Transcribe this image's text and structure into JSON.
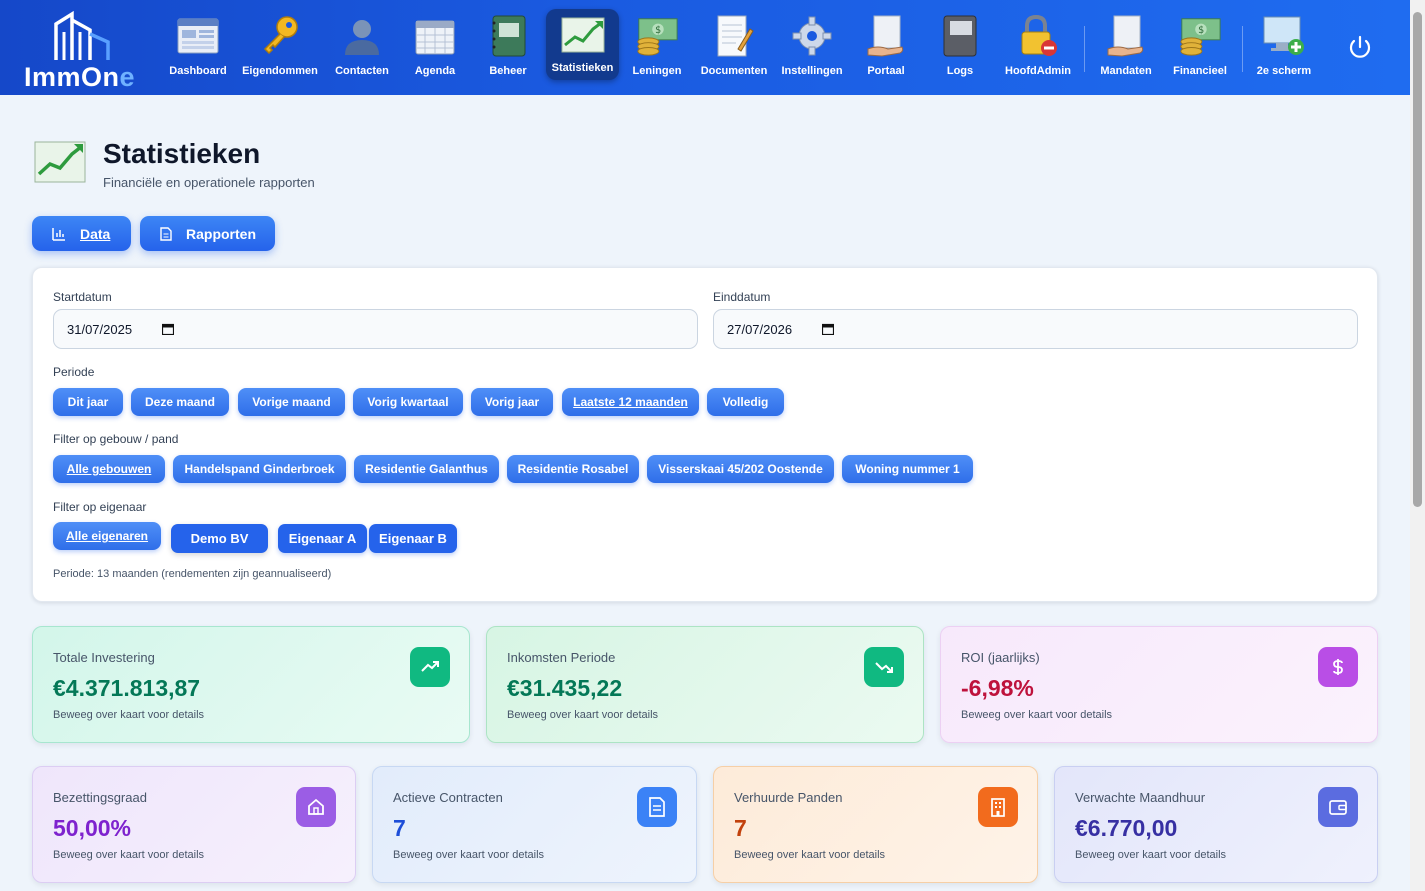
{
  "app": {
    "logo_text": "ImmOne"
  },
  "nav": {
    "items": [
      {
        "label": "Dashboard"
      },
      {
        "label": "Eigendommen"
      },
      {
        "label": "Contacten"
      },
      {
        "label": "Agenda"
      },
      {
        "label": "Beheer"
      },
      {
        "label": "Statistieken"
      },
      {
        "label": "Leningen"
      },
      {
        "label": "Documenten"
      },
      {
        "label": "Instellingen"
      },
      {
        "label": "Portaal"
      },
      {
        "label": "Logs"
      },
      {
        "label": "HoofdAdmin"
      },
      {
        "label": "Mandaten"
      },
      {
        "label": "Financieel"
      },
      {
        "label": "2e scherm"
      }
    ],
    "active": "Statistieken"
  },
  "page": {
    "title": "Statistieken",
    "subtitle": "Financiële en operationele rapporten"
  },
  "tabs": {
    "data": "Data",
    "rapporten": "Rapporten"
  },
  "filters": {
    "start_label": "Startdatum",
    "start_value": "31/07/2025",
    "end_label": "Einddatum",
    "end_value": "27/07/2026",
    "period_label": "Periode",
    "periods": [
      "Dit jaar",
      "Deze maand",
      "Vorige maand",
      "Vorig kwartaal",
      "Vorig jaar",
      "Laatste 12 maanden",
      "Volledig"
    ],
    "building_label": "Filter op gebouw / pand",
    "buildings": [
      "Alle gebouwen",
      "Handelspand Ginderbroek",
      "Residentie Galanthus",
      "Residentie Rosabel",
      "Visserskaai 45/202 Oostende",
      "Woning nummer 1"
    ],
    "owner_label": "Filter op eigenaar",
    "owners": [
      "Alle eigenaren",
      "Demo BV",
      "Eigenaar A",
      "Eigenaar B"
    ],
    "period_note": "Periode: 13 maanden (rendementen zijn geannualiseerd)"
  },
  "stats": {
    "hint": "Beweeg over kaart voor details",
    "cards": [
      {
        "label": "Totale Investering",
        "value": "€4.371.813,87",
        "color": "#047857"
      },
      {
        "label": "Inkomsten Periode",
        "value": "€31.435,22",
        "color": "#047857"
      },
      {
        "label": "ROI (jaarlijks)",
        "value": "-6,98%",
        "color": "#be123c"
      },
      {
        "label": "Bezettingsgraad",
        "value": "50,00%",
        "color": "#7e22ce"
      },
      {
        "label": "Actieve Contracten",
        "value": "7",
        "color": "#1d4ed8"
      },
      {
        "label": "Verhuurde Panden",
        "value": "7",
        "color": "#c2410c"
      },
      {
        "label": "Verwachte Maandhuur",
        "value": "€6.770,00",
        "color": "#3730a3"
      }
    ]
  }
}
